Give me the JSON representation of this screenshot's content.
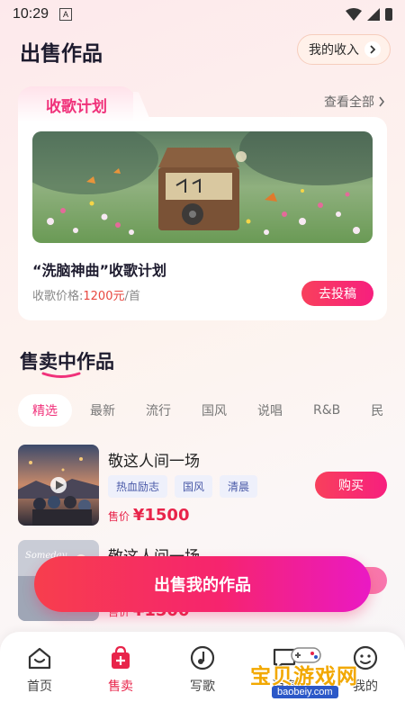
{
  "status_bar": {
    "time": "10:29",
    "notification_glyph": "A"
  },
  "header": {
    "title": "出售作品",
    "income_label": "我的收入",
    "income_icon": "chevron-right-icon"
  },
  "plan": {
    "tab_label": "收歌计划",
    "view_all_label": "查看全部",
    "name": "“洗脑神曲”收歌计划",
    "price_label": "收歌价格:",
    "price_value": "1200元",
    "price_unit": "/首",
    "submit_label": "去投稿"
  },
  "section": {
    "title": "售卖中作品"
  },
  "categories": [
    "精选",
    "最新",
    "流行",
    "国风",
    "说唱",
    "R&B",
    "民"
  ],
  "songs": [
    {
      "title": "敬这人间一场",
      "tags": [
        "热血励志",
        "国风",
        "清晨"
      ],
      "price_label": "售价",
      "price": "¥1500",
      "buy_label": "购买"
    },
    {
      "title": "敬这人间一场",
      "thumb_text": "Someday",
      "price_label": "售价",
      "price": "¥1500"
    }
  ],
  "cta": {
    "label": "出售我的作品"
  },
  "nav": [
    {
      "label": "首页",
      "icon": "home-icon"
    },
    {
      "label": "售卖",
      "icon": "sell-bag-icon"
    },
    {
      "label": "写歌",
      "icon": "music-note-icon"
    },
    {
      "label": "消息",
      "icon": "message-icon"
    },
    {
      "label": "我的",
      "icon": "profile-icon"
    }
  ],
  "watermark": {
    "text": "宝贝游戏网",
    "url": "baobeiy.com"
  },
  "colors": {
    "accent": "#f0317a",
    "price_red": "#e8244a",
    "tag_bg": "#eef0fb"
  }
}
